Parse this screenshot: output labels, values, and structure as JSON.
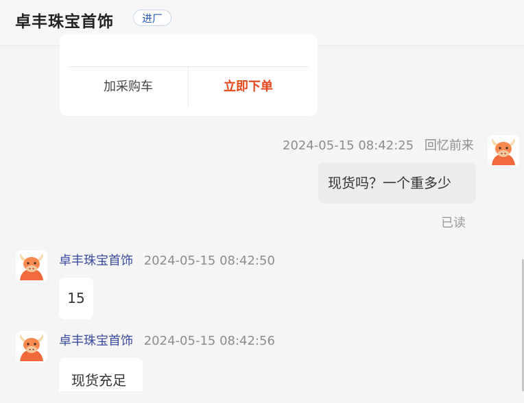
{
  "header": {
    "shop_name": "卓丰珠宝首饰",
    "enter_badge": "进厂"
  },
  "order_card": {
    "add_to_cart": "加采购车",
    "order_now": "立即下单"
  },
  "messages": [
    {
      "side": "right",
      "timestamp": "2024-05-15 08:42:25",
      "sender": "回忆前来",
      "text": "现货吗？一个重多少",
      "status": "已读"
    },
    {
      "side": "left",
      "sender": "卓丰珠宝首饰",
      "timestamp": "2024-05-15 08:42:50",
      "text": "15"
    },
    {
      "side": "left",
      "sender": "卓丰珠宝首饰",
      "timestamp": "2024-05-15 08:42:56",
      "text": "现货充足"
    }
  ],
  "colors": {
    "accent_order": "#e4471b",
    "sender_name": "#3a4aa0",
    "badge_text": "#2b55b8"
  },
  "icons": {
    "avatar": "cartoon-bull-avatar-icon"
  }
}
